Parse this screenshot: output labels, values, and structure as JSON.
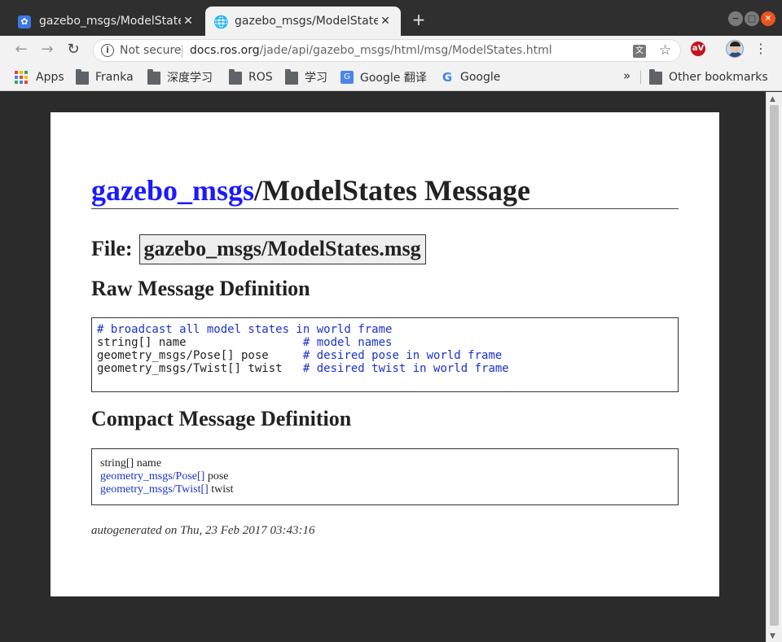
{
  "tabs": [
    {
      "title": "gazebo_msgs/ModelState",
      "favicon": "baidu-paw-icon",
      "close": "✕"
    },
    {
      "title": "gazebo_msgs/ModelState",
      "favicon": "globe-icon",
      "close": "✕"
    }
  ],
  "new_tab_label": "+",
  "window_controls": [
    "−",
    "□",
    "✕"
  ],
  "nav": {
    "back": "←",
    "forward": "→",
    "reload": "↻"
  },
  "omnibox": {
    "info_glyph": "i",
    "security_text": "Not secure",
    "url_host": "docs.ros.org",
    "url_path": "/jade/api/gazebo_msgs/html/msg/ModelStates.html",
    "translate_glyph": "文",
    "star_glyph": "☆"
  },
  "extension_label": "aV",
  "menu_glyph": "⋮",
  "bookmarks": {
    "items": [
      {
        "label": "Apps",
        "icon": "apps-grid-icon"
      },
      {
        "label": "Franka",
        "icon": "folder-icon"
      },
      {
        "label": "深度学习",
        "icon": "folder-icon"
      },
      {
        "label": "ROS",
        "icon": "folder-icon"
      },
      {
        "label": "学习",
        "icon": "folder-icon"
      },
      {
        "label": "Google 翻译",
        "icon": "google-translate-icon"
      },
      {
        "label": "Google",
        "icon": "google-icon"
      }
    ],
    "overflow": "»",
    "other": "Other bookmarks"
  },
  "page": {
    "title_link": "gazebo_msgs",
    "title_rest": "/ModelStates Message",
    "file_label": "File:",
    "file_name": "gazebo_msgs/ModelStates.msg",
    "raw_heading": "Raw Message Definition",
    "raw_lines": [
      {
        "code": "",
        "comment": "# broadcast all model states in world frame"
      },
      {
        "code": "string[] name                 ",
        "comment": "# model names"
      },
      {
        "code": "geometry_msgs/Pose[] pose     ",
        "comment": "# desired pose in world frame"
      },
      {
        "code": "geometry_msgs/Twist[] twist   ",
        "comment": "# desired twist in world frame"
      }
    ],
    "compact_heading": "Compact Message Definition",
    "compact_lines": [
      {
        "type": "string[]",
        "link": false,
        "name": "name"
      },
      {
        "type": "geometry_msgs/Pose[]",
        "link": true,
        "name": "pose"
      },
      {
        "type": "geometry_msgs/Twist[]",
        "link": true,
        "name": "twist"
      }
    ],
    "autogenerated": "autogenerated on Thu, 23 Feb 2017 03:43:16"
  },
  "colors": {
    "link": "#1a1aff",
    "comment": "#1a33cc",
    "chrome_dark": "#2f2f2f",
    "chrome_light": "#f2f2f2"
  }
}
